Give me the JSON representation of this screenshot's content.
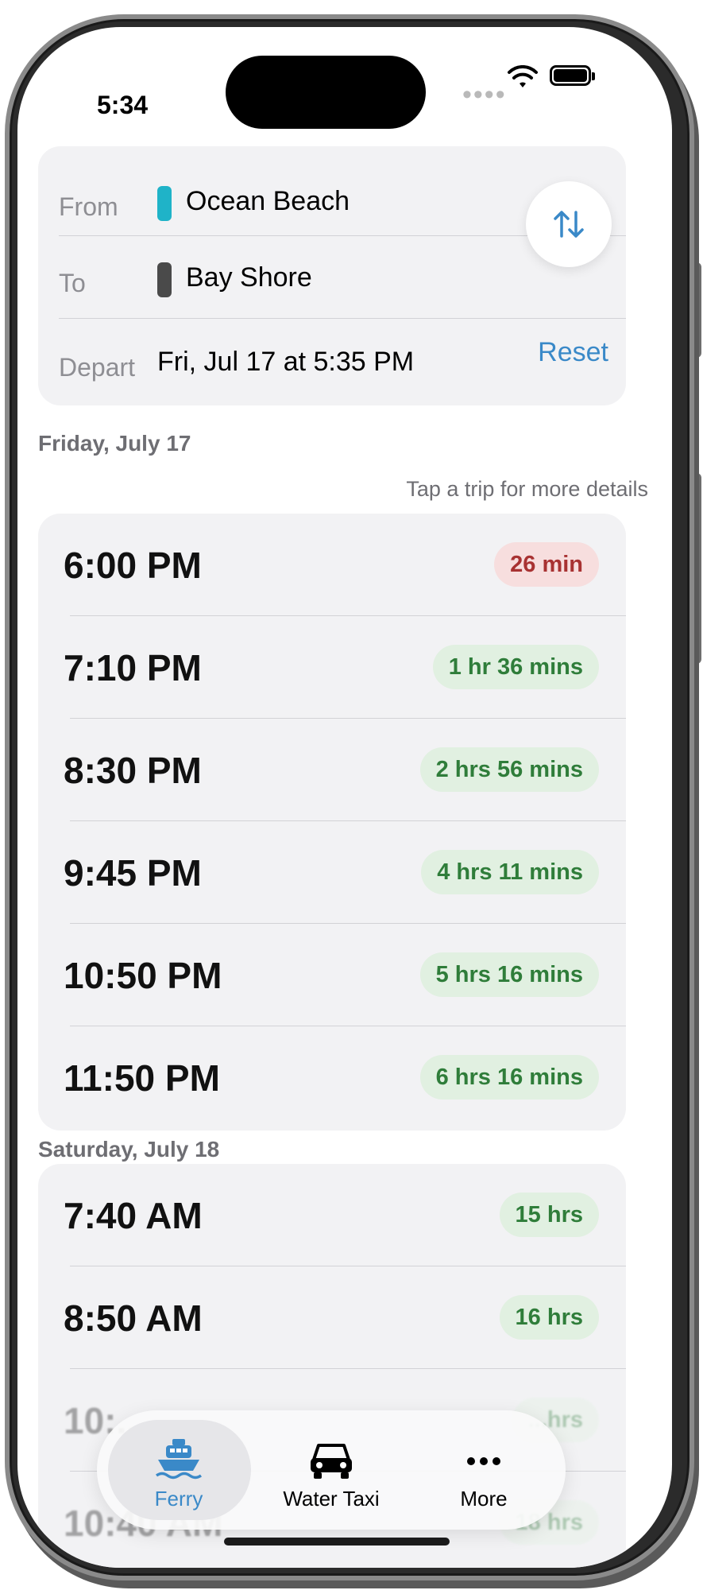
{
  "status_bar": {
    "time": "5:34"
  },
  "route": {
    "from_label": "From",
    "from_value": "Ocean Beach",
    "from_color": "#1fb3c8",
    "to_label": "To",
    "to_value": "Bay Shore",
    "to_color": "#4a4a4a",
    "depart_label": "Depart",
    "depart_value": "Fri, Jul 17 at 5:35 PM",
    "reset_label": "Reset"
  },
  "hint": "Tap a trip for more details",
  "sections": [
    {
      "header": "Friday, July 17",
      "trips": [
        {
          "time": "6:00 PM",
          "duration": "26 min",
          "status": "red"
        },
        {
          "time": "7:10 PM",
          "duration": "1 hr 36 mins",
          "status": "green"
        },
        {
          "time": "8:30 PM",
          "duration": "2 hrs 56 mins",
          "status": "green"
        },
        {
          "time": "9:45 PM",
          "duration": "4 hrs 11 mins",
          "status": "green"
        },
        {
          "time": "10:50 PM",
          "duration": "5 hrs 16 mins",
          "status": "green"
        },
        {
          "time": "11:50 PM",
          "duration": "6 hrs 16 mins",
          "status": "green"
        }
      ]
    },
    {
      "header": "Saturday, July 18",
      "trips": [
        {
          "time": "7:40 AM",
          "duration": "15 hrs",
          "status": "green"
        },
        {
          "time": "8:50 AM",
          "duration": "16 hrs",
          "status": "green"
        },
        {
          "time": "10:...",
          "duration": "...hrs",
          "status": "green"
        },
        {
          "time": "10:40 AM",
          "duration": "18 hrs",
          "status": "green"
        }
      ]
    }
  ],
  "tab_bar": {
    "ferry_label": "Ferry",
    "water_taxi_label": "Water Taxi",
    "more_label": "More",
    "active_color": "#3a89c8"
  },
  "colors": {
    "accent": "#3a89c8",
    "badge_red_bg": "#f7dede",
    "badge_red_text": "#a83232",
    "badge_green_bg": "#e1f0e1",
    "badge_green_text": "#2f7d3a"
  }
}
